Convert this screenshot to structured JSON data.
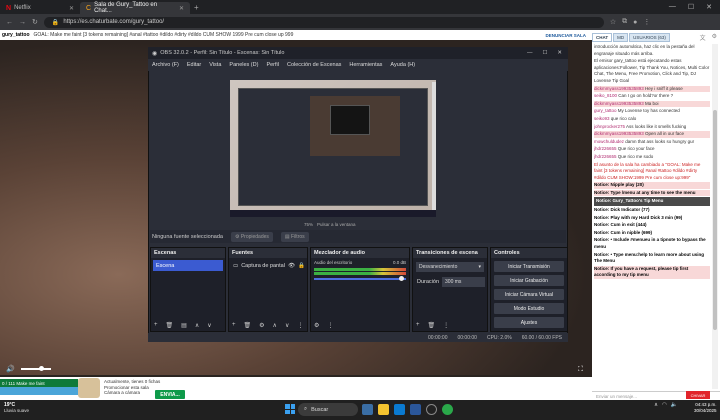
{
  "browser": {
    "tabs": [
      {
        "label": "Netflix",
        "icon": "N"
      },
      {
        "label": "Sala de Gury_Tattoo en Chat...",
        "icon": "cb"
      }
    ],
    "new_tab": "+",
    "url": "https://es.chaturbate.com/gury_tattoo/",
    "window_controls": [
      "—",
      "☐",
      "✕"
    ]
  },
  "page": {
    "username": "gury_tattoo",
    "goal_text": "GOAL: Make me faint [3 tokens remaining] #anal #tattoo #dildo #dirty #dildo CUM SHOW 1999 Pre cum close up 999",
    "scale_label": "DENUNCIAR SALA",
    "tip_goal": "0 / 111 Make me faint",
    "info_lines": [
      "Actualmente, tienes 0 fichas",
      "Promocionar esta sala",
      "Cámara a cámara"
    ],
    "send_label": "ENVIA..."
  },
  "obs": {
    "title": "OBS 32.0.2 - Perfil: Sin Título - Escenas: Sin Título",
    "menu": [
      "Archivo (F)",
      "Editar",
      "Vista",
      "Paneles (D)",
      "Perfil",
      "Colección de Escenas",
      "Herramientas",
      "Ayuda (H)"
    ],
    "below_preview": [
      "75%",
      "Pulsar a la ventana"
    ],
    "no_source": "Ninguna fuente seleccionada",
    "properties": "Propiedades",
    "filters": "Filtros",
    "scenes": {
      "title": "Escenas",
      "items": [
        "Escena"
      ]
    },
    "sources": {
      "title": "Fuentes",
      "items": [
        "Captura de pantal"
      ]
    },
    "mixer": {
      "title": "Mezclador de audio",
      "track": "Audio del escritorio",
      "db": "0.0 dB"
    },
    "transitions": {
      "title": "Transiciones de escena",
      "selected": "Desvanecimiento",
      "duration_label": "Duración",
      "duration": "300 ms"
    },
    "controls": {
      "title": "Controles",
      "buttons": [
        "Iniciar Transmisión",
        "Iniciar Grabación",
        "Iniciar Cámara Virtual",
        "Modo Estudio",
        "Ajustes"
      ]
    },
    "status": [
      "00:00:00",
      "00:00:00",
      "CPU: 2.0%",
      "60.00 / 60.00 FPS"
    ]
  },
  "chat": {
    "tabs": [
      "CHAT",
      "MD",
      "USUARIOS (63)"
    ],
    "messages": [
      {
        "cls": "",
        "text": "introducción automática, haz clic en la pestaña del engranaje situado más arriba."
      },
      {
        "cls": "",
        "text": "El emisor gary_tattoo está ejecutando estas aplicaciones:Follower, Tip Thank You, Notices, Multi Color Chat, The Menu, Free Promotion, Click and Tip, DJ Lovense Tip Goal"
      },
      {
        "cls": "hl",
        "user": "dickmmyass1993535893",
        "text": " Hey i sniff it please"
      },
      {
        "cls": "",
        "user": "seiko_8100",
        "text": " Can I go on hold?or there ?"
      },
      {
        "cls": "hl",
        "user": "dickmmyass1993535893",
        "text": " Ma boi"
      },
      {
        "cls": "",
        "user": "gury_tattoo",
        "text": " My Lovense toy has connected"
      },
      {
        "cls": "",
        "user": "seiko93",
        "text": " que rico calo"
      },
      {
        "cls": "",
        "user": "johnprocker275",
        "text": " Ass looks like it smells fucking"
      },
      {
        "cls": "hl",
        "user": "dickmmyass1993535893",
        "text": " Open all in our face"
      },
      {
        "cls": "",
        "user": "mowchuldudez",
        "text": " damn that ass looks so hungry gur"
      },
      {
        "cls": "",
        "user": "jhdr226655",
        "text": " Que rico your face"
      },
      {
        "cls": "",
        "user": "jhdr226655",
        "text": " Que rico me sodo"
      },
      {
        "cls": "red",
        "text": "El asunto de la sala ha cambiado a \"GOAL: Make me faint [3 tokens remaining] #anal #tattoo #dildo #dirty #dildo CUM SHOW:1999 Pre cum close up:999\""
      },
      {
        "cls": "hl",
        "text": "Notice: Nipple play (20)"
      },
      {
        "cls": "hl",
        "text": "Notice: Type /menu at any time to see the menu"
      },
      {
        "cls": "bar",
        "text": "Notice: Gury_Tattoo's Tip Menu"
      },
      {
        "cls": "",
        "text": "Notice: Dick Indicator (77)"
      },
      {
        "cls": "",
        "text": "Notice: Play with my Hard Dick 3 min (99)"
      },
      {
        "cls": "",
        "text": "Notice: Cum in exit (444)"
      },
      {
        "cls": "",
        "text": "Notice: Cum in nipble (699)"
      },
      {
        "cls": "",
        "text": "Notice: • Include #menueu in a tipnote to bypass the menu"
      },
      {
        "cls": "",
        "text": "Notice: • Type menu:help to learn more about using The Menu"
      },
      {
        "cls": "hl",
        "text": "Notice: If you have a request, please tip first according to my tip menu"
      }
    ],
    "input_placeholder": "Enviar un mensaje...",
    "chivar": "CHIVAR"
  },
  "taskbar": {
    "weather_temp": "19°C",
    "weather_desc": "Lluvia suave",
    "search": "Buscar",
    "time": "04:43 p.m.",
    "date": "30/04/2025"
  },
  "colors": {
    "accent": "#3b5bd1",
    "chat_red": "#cc2222",
    "send_green": "#0e9a4a"
  }
}
